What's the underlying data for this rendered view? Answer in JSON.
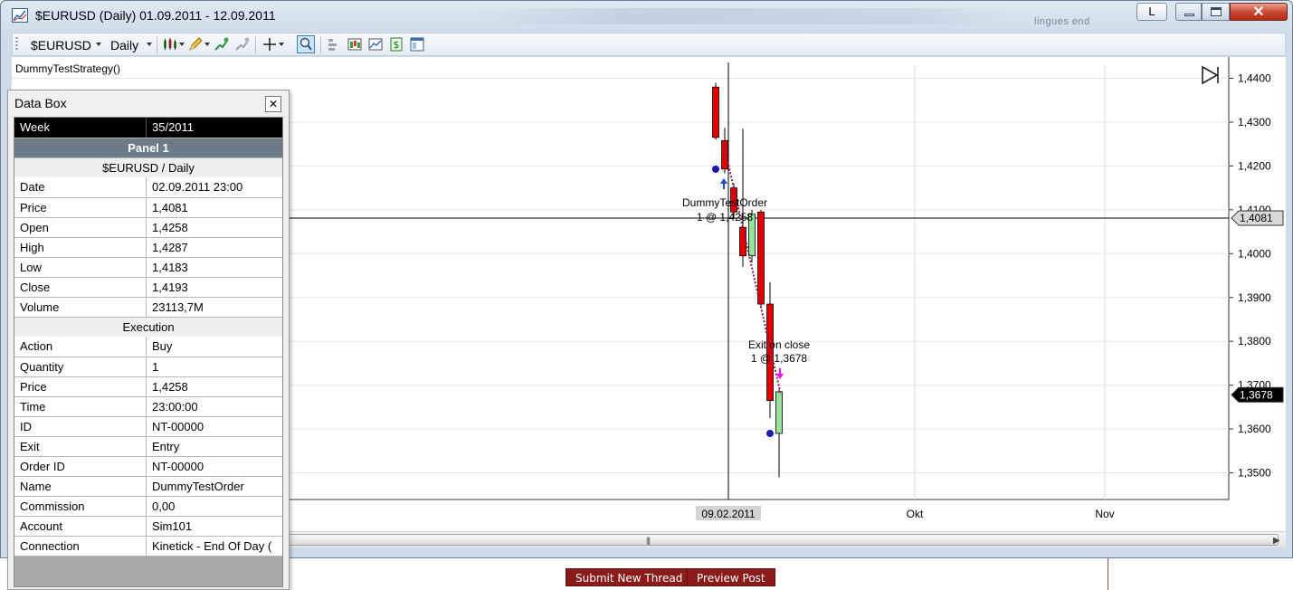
{
  "window": {
    "title": "$EURUSD (Daily)  01.09.2011 - 12.09.2011",
    "blurred_text": "lingues end",
    "l_button": "L"
  },
  "toolbar": {
    "instrument": "$EURUSD",
    "period": "Daily"
  },
  "chart": {
    "strategy_label": "DummyTestStrategy()",
    "y_ticks": [
      "1,4400",
      "1,4300",
      "1,4200",
      "1,4100",
      "1,4000",
      "1,3900",
      "1,3800",
      "1,3700",
      "1,3600",
      "1,3500"
    ],
    "x_labels": {
      "cursor_date": "09.02.2011",
      "okt": "Okt",
      "nov": "Nov"
    },
    "price_tags": {
      "crosshair": "1,4081",
      "last": "1,3678"
    },
    "annotations": {
      "entry_line1": "DummyTestOrder",
      "entry_line2": "1 @ 1,4258",
      "exit_line1": "Exit on close",
      "exit_line2": "1 @ 1,3678"
    },
    "colors": {
      "up": "#98e39c",
      "down": "#e00000",
      "entry_arrow": "#1c49e0",
      "exit_arrow": "#ff00ff",
      "marker": "#1a1ab0"
    }
  },
  "chart_data": {
    "type": "candlestick",
    "ylim": [
      1.345,
      1.445
    ],
    "candles": [
      {
        "open": 1.438,
        "high": 1.439,
        "low": 1.426,
        "close": 1.4265
      },
      {
        "open": 1.4258,
        "high": 1.4287,
        "low": 1.4183,
        "close": 1.4193
      },
      {
        "open": 1.415,
        "high": 1.416,
        "low": 1.408,
        "close": 1.4095
      },
      {
        "open": 1.406,
        "high": 1.4285,
        "low": 1.397,
        "close": 1.3995
      },
      {
        "open": 1.3995,
        "high": 1.41,
        "low": 1.398,
        "close": 1.409
      },
      {
        "open": 1.4095,
        "high": 1.41,
        "low": 1.388,
        "close": 1.3885
      },
      {
        "open": 1.3885,
        "high": 1.3935,
        "low": 1.3625,
        "close": 1.3665
      },
      {
        "open": 1.359,
        "high": 1.369,
        "low": 1.349,
        "close": 1.3685
      }
    ],
    "crosshair_price": 1.4081,
    "last_price": 1.3678
  },
  "databox": {
    "title": "Data Box",
    "week_label": "Week",
    "week_value": "35/2011",
    "panel": "Panel 1",
    "series": "$EURUSD / Daily",
    "rows1": [
      {
        "k": "Date",
        "v": "02.09.2011 23:00"
      },
      {
        "k": "Price",
        "v": "1,4081"
      },
      {
        "k": "Open",
        "v": "1,4258"
      },
      {
        "k": "High",
        "v": "1,4287"
      },
      {
        "k": "Low",
        "v": "1,4183"
      },
      {
        "k": "Close",
        "v": "1,4193"
      },
      {
        "k": "Volume",
        "v": "23113,7M"
      }
    ],
    "section2": "Execution",
    "rows2": [
      {
        "k": "Action",
        "v": "Buy"
      },
      {
        "k": "Quantity",
        "v": "1"
      },
      {
        "k": "Price",
        "v": "1,4258"
      },
      {
        "k": "Time",
        "v": "23:00:00"
      },
      {
        "k": "ID",
        "v": "NT-00000"
      },
      {
        "k": "Exit",
        "v": "Entry"
      },
      {
        "k": "Order ID",
        "v": "NT-00000"
      },
      {
        "k": "Name",
        "v": "DummyTestOrder"
      },
      {
        "k": "Commission",
        "v": "0,00"
      },
      {
        "k": "Account",
        "v": "Sim101"
      },
      {
        "k": "Connection",
        "v": "Kinetick - End Of Day ("
      }
    ]
  },
  "forum": {
    "submit": "Submit New Thread",
    "preview": "Preview Post"
  }
}
